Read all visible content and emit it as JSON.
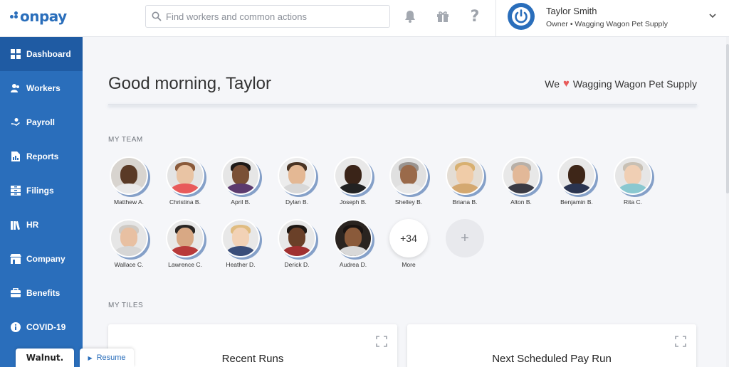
{
  "brand": {
    "logo_text": "onpay",
    "accent": "#2a6ebb"
  },
  "search": {
    "placeholder": "Find workers and common actions"
  },
  "top_icons": [
    "bell-icon",
    "gift-icon",
    "help-icon"
  ],
  "help_glyph": "?",
  "user": {
    "name": "Taylor Smith",
    "role": "Owner • Wagging Wagon Pet Supply"
  },
  "sidebar": {
    "items": [
      {
        "label": "Dashboard",
        "icon": "dashboard-icon",
        "active": true
      },
      {
        "label": "Workers",
        "icon": "workers-icon"
      },
      {
        "label": "Payroll",
        "icon": "payroll-icon"
      },
      {
        "label": "Reports",
        "icon": "reports-icon"
      },
      {
        "label": "Filings",
        "icon": "filings-icon"
      },
      {
        "label": "HR",
        "icon": "hr-icon"
      },
      {
        "label": "Company",
        "icon": "company-icon"
      },
      {
        "label": "Benefits",
        "icon": "benefits-icon"
      },
      {
        "label": "COVID-19",
        "icon": "info-icon"
      }
    ]
  },
  "main": {
    "greeting": "Good morning, Taylor",
    "we_love_prefix": "We",
    "heart": "♥",
    "company_name": "Wagging Wagon Pet Supply",
    "my_team_label": "MY TEAM",
    "my_tiles_label": "MY TILES",
    "team": [
      {
        "name": "Matthew A."
      },
      {
        "name": "Christina B."
      },
      {
        "name": "April B."
      },
      {
        "name": "Dylan B."
      },
      {
        "name": "Joseph B."
      },
      {
        "name": "Shelley B."
      },
      {
        "name": "Briana B."
      },
      {
        "name": "Alton B."
      },
      {
        "name": "Benjamin B."
      },
      {
        "name": "Rita C."
      },
      {
        "name": "Wallace C."
      },
      {
        "name": "Lawrence C."
      },
      {
        "name": "Heather D."
      },
      {
        "name": "Derick D."
      },
      {
        "name": "Audrea D."
      }
    ],
    "more": {
      "count": "+34",
      "label": "More"
    },
    "add_glyph": "+",
    "tiles": [
      {
        "title": "Recent Runs"
      },
      {
        "title": "Next Scheduled Pay Run"
      }
    ]
  },
  "walnut": {
    "logo_text": "Walnut.",
    "resume_label": "Resume",
    "play_glyph": "▶"
  }
}
